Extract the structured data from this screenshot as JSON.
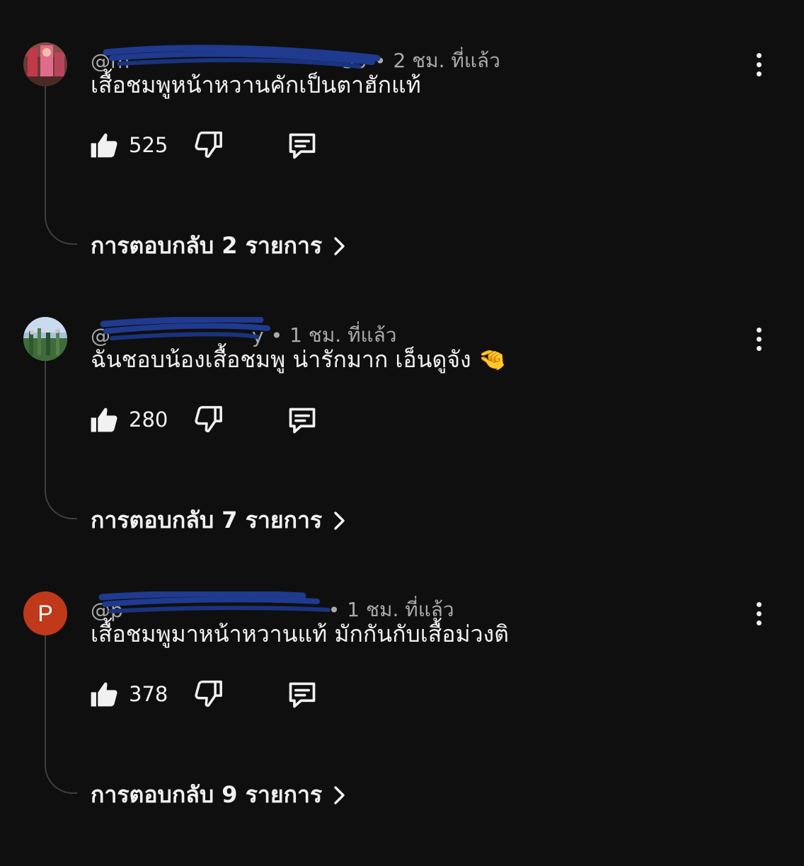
{
  "comments": [
    {
      "handle": "@m",
      "handle_tail": "59",
      "time": "2 ชม. ที่แล้ว",
      "text": "เสื้อชมพูหน้าหวานคักเป็นตาฮักแท้",
      "likes": "525",
      "replies_label": "การตอบกลับ 2 รายการ"
    },
    {
      "handle": "@",
      "handle_tail": "y",
      "time": "1 ชม. ที่แล้ว",
      "text": "ฉันชอบน้องเสื้อชมพู น่ารักมาก เอ็นดูจัง 🤏",
      "likes": "280",
      "replies_label": "การตอบกลับ 7 รายการ"
    },
    {
      "handle": "@p",
      "handle_tail": "",
      "avatar_letter": "P",
      "time": "1 ชม. ที่แล้ว",
      "text": "เสื้อชมพูมาหน้าหวานแท้ มักกันกับเสื้อม่วงติ",
      "likes": "378",
      "replies_label": "การตอบกลับ 9 รายการ"
    }
  ],
  "icons": {
    "like": "thumbs-up-icon",
    "dislike": "thumbs-down-icon",
    "reply": "comment-icon",
    "menu": "more-vert-icon",
    "replies": "chevron-right-icon"
  },
  "colors": {
    "background": "#0f0f0f",
    "text": "#f1f1f1",
    "meta": "#aaaaaa",
    "avatar_p": "#c0391b",
    "redaction": "#1f3a8f"
  }
}
